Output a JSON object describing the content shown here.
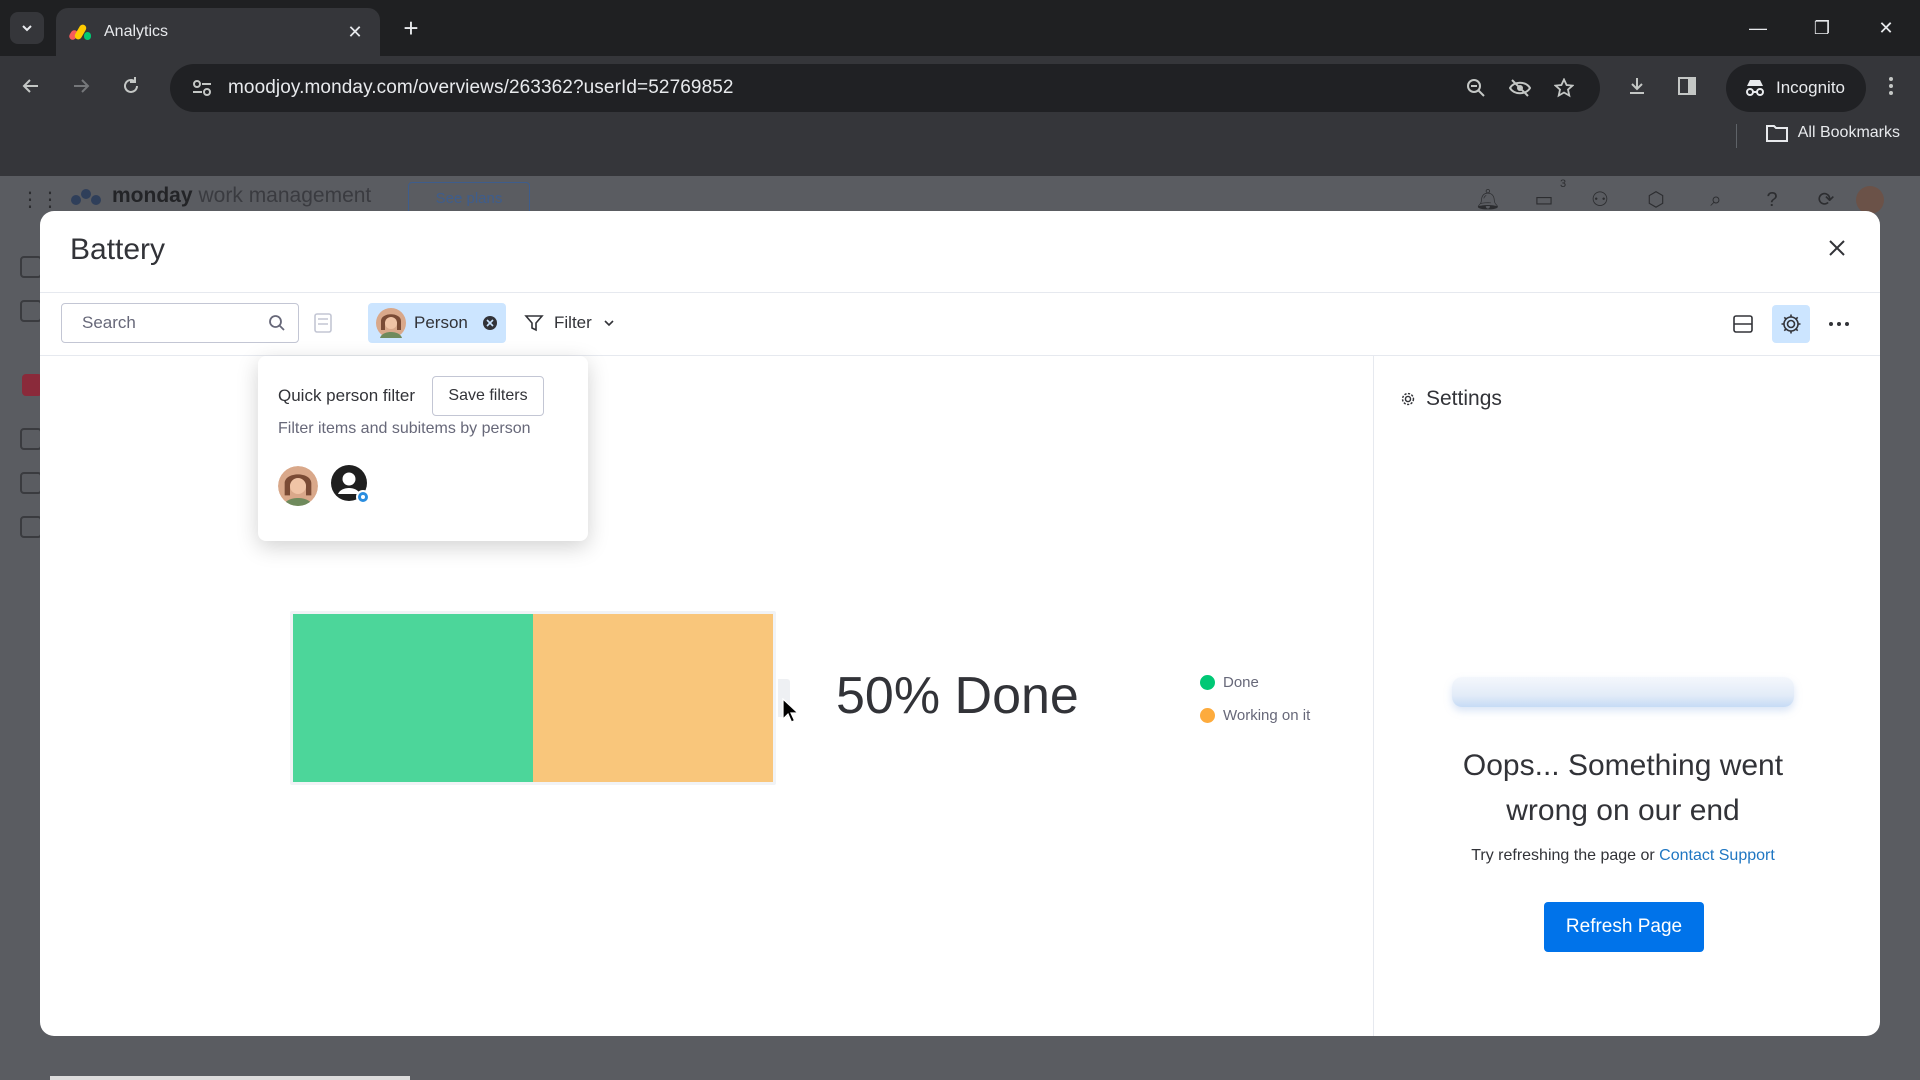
{
  "browser": {
    "tab_title": "Analytics",
    "url": "moodjoy.monday.com/overviews/263362?userId=52769852",
    "incognito_label": "Incognito",
    "bookmarks_label": "All Bookmarks"
  },
  "app": {
    "logo_brand": "monday",
    "logo_product": "work management",
    "see_plans": "See plans",
    "inbox_badge": "3"
  },
  "modal": {
    "title": "Battery",
    "search_placeholder": "Search",
    "person_chip_label": "Person",
    "filter_label": "Filter"
  },
  "popover": {
    "title": "Quick person filter",
    "save_filters": "Save filters",
    "subtitle": "Filter items and subitems by person"
  },
  "widget": {
    "done_text": "50% Done",
    "segments": [
      {
        "label": "Done",
        "fraction": 0.5,
        "color": "#4cd69a"
      },
      {
        "label": "Working on it",
        "fraction": 0.5,
        "color": "#f9c67b"
      }
    ],
    "legend": [
      {
        "label": "Done",
        "color": "#00c875"
      },
      {
        "label": "Working on it",
        "color": "#fdab3d"
      }
    ]
  },
  "settings": {
    "heading": "Settings",
    "error_title": "Oops... Something went wrong on our end",
    "error_sub_prefix": "Try refreshing the page or",
    "error_link": "Contact Support",
    "refresh_button": "Refresh Page"
  },
  "colors": {
    "primary": "#0073ea",
    "chip_bg": "#cce5ff"
  },
  "icons": [
    "tab-search-icon",
    "analytics-favicon",
    "close-icon",
    "plus-icon",
    "back-icon",
    "forward-icon",
    "reload-icon",
    "site-settings-icon",
    "zoom-icon",
    "eye-off-icon",
    "star-icon",
    "download-icon",
    "side-panel-icon",
    "incognito-icon",
    "menu-icon",
    "folder-icon",
    "search-icon",
    "save-view-icon",
    "filter-icon",
    "chevron-down-icon",
    "layout-icon",
    "gear-icon",
    "more-icon",
    "cursor-icon"
  ]
}
